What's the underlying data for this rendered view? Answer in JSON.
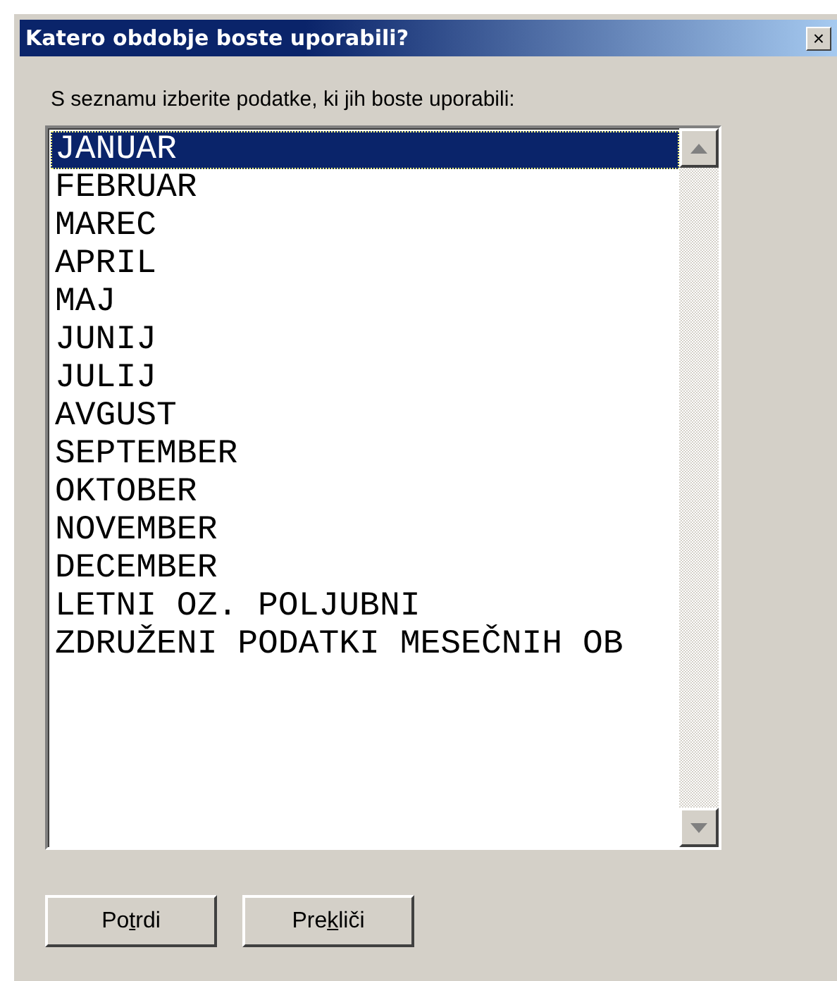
{
  "window": {
    "title": "Katero obdobje boste uporabili?",
    "close": "×"
  },
  "prompt": "S seznamu izberite podatke, ki jih boste uporabili:",
  "list": [
    {
      "label": "JANUAR",
      "selected": true
    },
    {
      "label": "FEBRUAR",
      "selected": false
    },
    {
      "label": "MAREC",
      "selected": false
    },
    {
      "label": "APRIL",
      "selected": false
    },
    {
      "label": "MAJ",
      "selected": false
    },
    {
      "label": "JUNIJ",
      "selected": false
    },
    {
      "label": "JULIJ",
      "selected": false
    },
    {
      "label": "AVGUST",
      "selected": false
    },
    {
      "label": "SEPTEMBER",
      "selected": false
    },
    {
      "label": "OKTOBER",
      "selected": false
    },
    {
      "label": "NOVEMBER",
      "selected": false
    },
    {
      "label": "DECEMBER",
      "selected": false
    },
    {
      "label": "LETNI OZ. POLJUBNI",
      "selected": false
    },
    {
      "label": "ZDRUŽENI PODATKI MESEČNIH OB",
      "selected": false
    }
  ],
  "buttons": [
    {
      "before": "Po",
      "key": "t",
      "after": "rdi"
    },
    {
      "before": "Pre",
      "key": "k",
      "after": "liči"
    }
  ]
}
